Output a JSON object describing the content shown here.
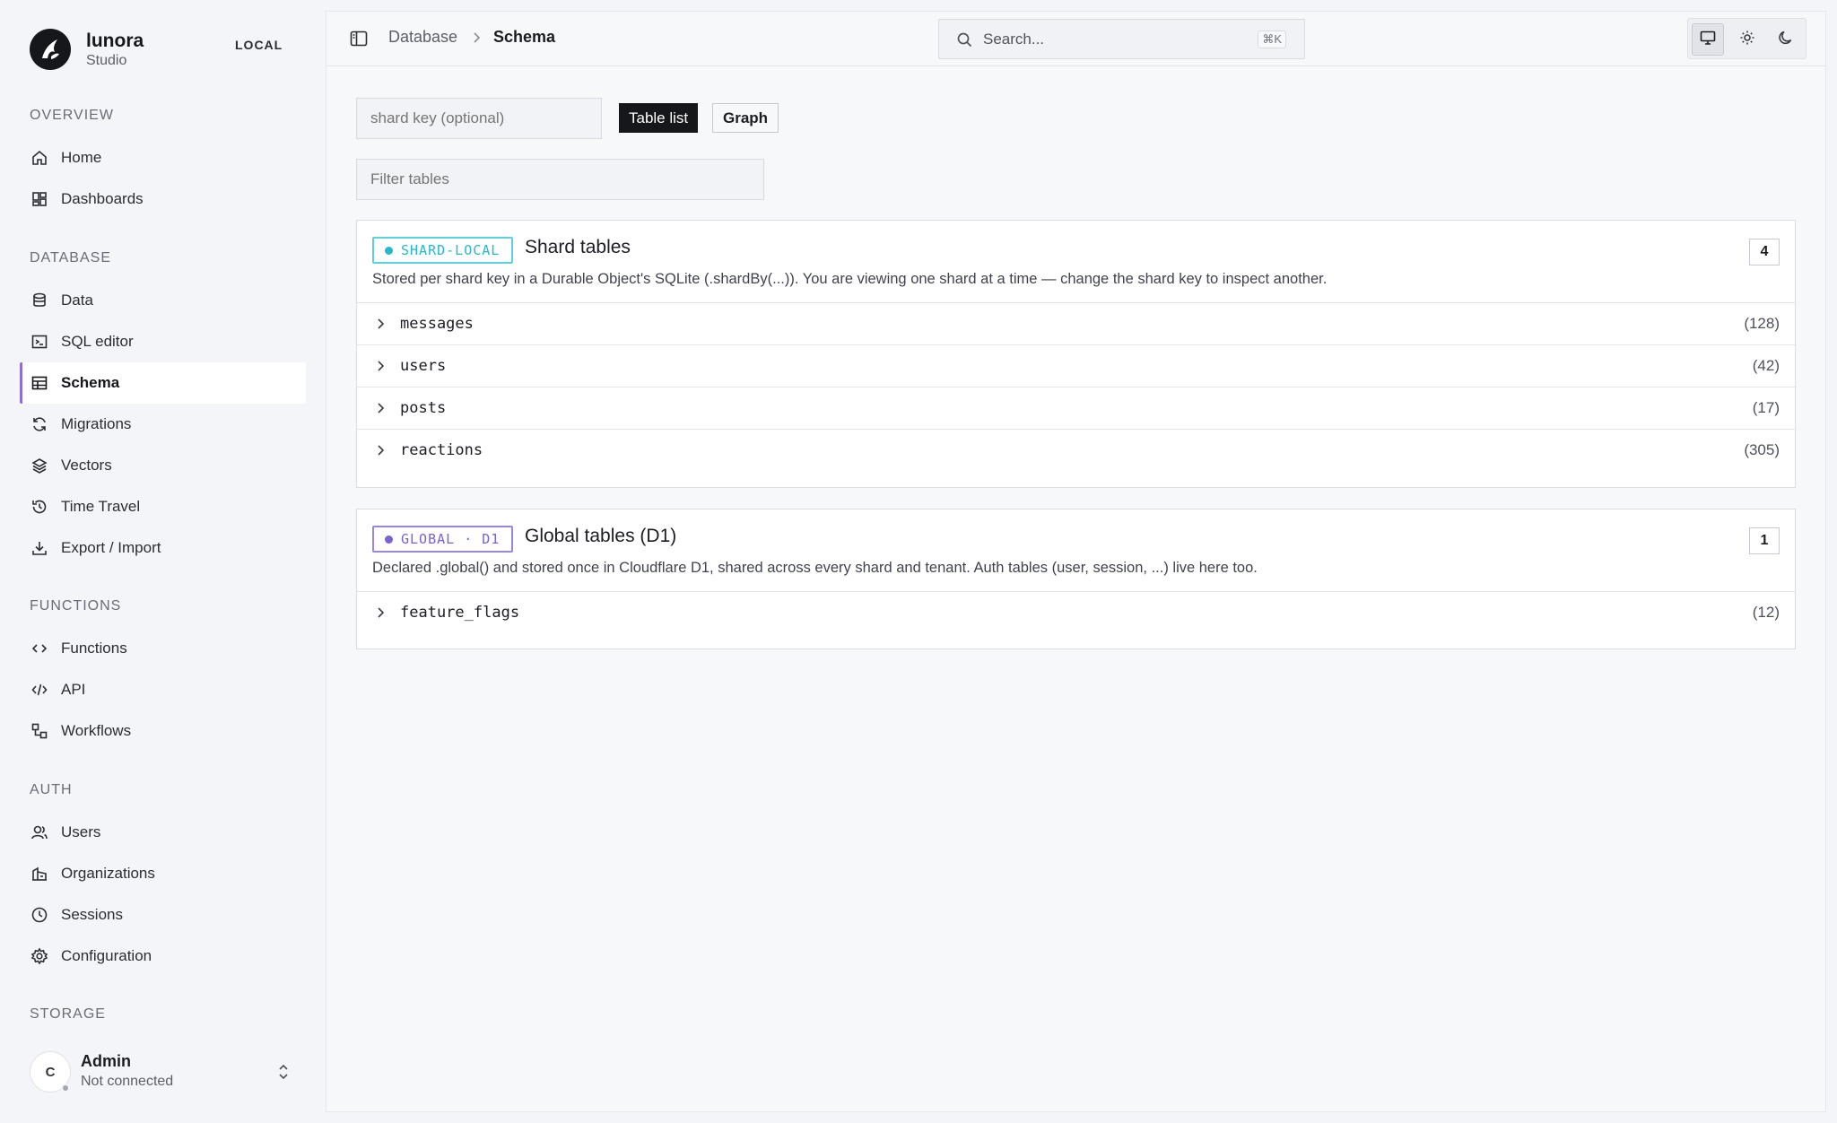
{
  "brand": {
    "name": "lunora",
    "subtitle": "Studio",
    "env_badge": "LOCAL"
  },
  "nav": {
    "sections": [
      {
        "title": "OVERVIEW",
        "items": [
          {
            "label": "Home",
            "icon": "home-icon"
          },
          {
            "label": "Dashboards",
            "icon": "dashboard-icon"
          }
        ]
      },
      {
        "title": "DATABASE",
        "items": [
          {
            "label": "Data",
            "icon": "database-icon"
          },
          {
            "label": "SQL editor",
            "icon": "terminal-icon"
          },
          {
            "label": "Schema",
            "icon": "table-icon",
            "active": true
          },
          {
            "label": "Migrations",
            "icon": "refresh-icon"
          },
          {
            "label": "Vectors",
            "icon": "layers-icon"
          },
          {
            "label": "Time Travel",
            "icon": "history-icon"
          },
          {
            "label": "Export / Import",
            "icon": "download-icon"
          }
        ]
      },
      {
        "title": "FUNCTIONS",
        "items": [
          {
            "label": "Functions",
            "icon": "code-icon"
          },
          {
            "label": "API",
            "icon": "api-icon"
          },
          {
            "label": "Workflows",
            "icon": "workflow-icon"
          }
        ]
      },
      {
        "title": "AUTH",
        "items": [
          {
            "label": "Users",
            "icon": "users-icon"
          },
          {
            "label": "Organizations",
            "icon": "building-icon"
          },
          {
            "label": "Sessions",
            "icon": "clock-icon"
          },
          {
            "label": "Configuration",
            "icon": "gear-icon"
          }
        ]
      },
      {
        "title": "STORAGE",
        "items": []
      }
    ]
  },
  "user": {
    "initial": "C",
    "name": "Admin",
    "status": "Not connected"
  },
  "topbar": {
    "breadcrumb": [
      "Database",
      "Schema"
    ],
    "search_placeholder": "Search...",
    "search_shortcut": "⌘K",
    "theme_modes": [
      "system",
      "light",
      "dark"
    ],
    "theme_selected": "system"
  },
  "toolbar": {
    "shard_key_placeholder": "shard key (optional)",
    "tabs": [
      "Table list",
      "Graph"
    ],
    "active_tab": "Table list",
    "filter_placeholder": "Filter tables"
  },
  "colors": {
    "accent": "#8b6fd6",
    "shard_badge": "#26b8cc",
    "global_badge": "#7a62cf",
    "dark": "#16171b"
  },
  "panels": [
    {
      "badge": "SHARD-LOCAL",
      "title": "Shard tables",
      "count": "4",
      "description": "Stored per shard key in a Durable Object's SQLite (.shardBy(...)). You are viewing one shard at a time — change the shard key to inspect another.",
      "tables": [
        {
          "name": "messages",
          "count": "(128)"
        },
        {
          "name": "users",
          "count": "(42)"
        },
        {
          "name": "posts",
          "count": "(17)"
        },
        {
          "name": "reactions",
          "count": "(305)"
        }
      ]
    },
    {
      "badge": "GLOBAL · D1",
      "title": "Global tables (D1)",
      "count": "1",
      "description": "Declared .global() and stored once in Cloudflare D1, shared across every shard and tenant. Auth tables (user, session, ...) live here too.",
      "tables": [
        {
          "name": "feature_flags",
          "count": "(12)"
        }
      ]
    }
  ]
}
